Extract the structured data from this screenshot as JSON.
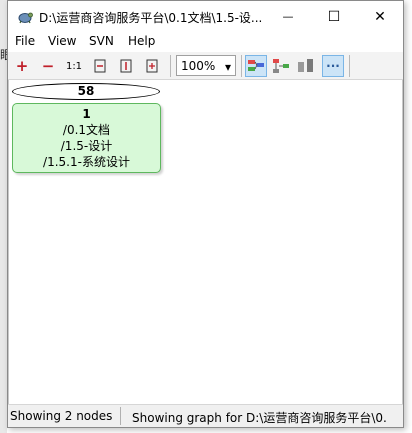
{
  "window": {
    "title": "D:\\运营商咨询服务平台\\0.1文档\\1.5-设...",
    "minimize_symbol": "—",
    "maximize_symbol": "☐",
    "close_symbol": "✕"
  },
  "background_fragment": "眼",
  "menu": [
    {
      "label": "File"
    },
    {
      "label": "View"
    },
    {
      "label": "SVN"
    },
    {
      "label": "Help"
    }
  ],
  "toolbar": {
    "zoom_in_icon": "+",
    "zoom_out_icon": "−",
    "zoom_actual_label": "1:1",
    "zoom_value": "100%",
    "zoom_arrow": "▾",
    "more_label": "···"
  },
  "graph": {
    "head_revision": "58",
    "node": {
      "revision": "1",
      "paths": [
        "/0.1文档",
        "/1.5-设计",
        "/1.5.1-系统设计"
      ]
    }
  },
  "status": {
    "left": "Showing 2 nodes",
    "right": "Showing graph for D:\\运营商咨询服务平台\\0."
  },
  "colors": {
    "node_fill": "#d8f9d8",
    "node_border": "#5eb85e",
    "toolbar_active": "#cce4f7"
  }
}
